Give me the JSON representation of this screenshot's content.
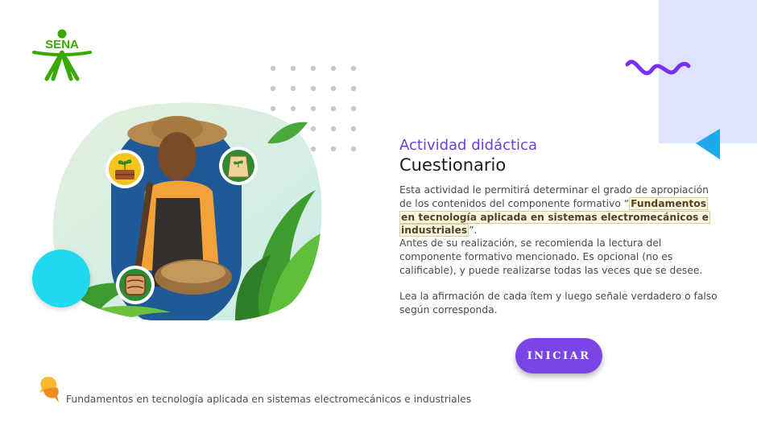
{
  "logo": {
    "text": "SENA",
    "color": "#39a900"
  },
  "activity": {
    "eyebrow": "Actividad didáctica",
    "title": "Cuestionario",
    "intro_prefix": "Esta actividad le permitirá determinar el grado de apropiación de los contenidos del componente formativo “",
    "intro_highlight": "Fundamentos en tecnología aplicada en sistemas electromecánicos e industriales",
    "intro_suffix": "”.",
    "recommendation": "Antes de su realización, se recomienda la lectura del componente formativo mencionado.  Es opcional (no es calificable), y puede realizarse todas las veces que se desee.",
    "instruction": "Lea la afirmación de cada ítem y luego señale verdadero o falso según corresponda."
  },
  "start_button": {
    "label": "INICIAR"
  },
  "footer": {
    "text": "Fundamentos en tecnología aplicada en sistemas electromecánicos e industriales"
  },
  "icons": {
    "logo": "sena-logo-icon",
    "wave": "wave-decoration-icon",
    "triangle": "triangle-decoration-icon",
    "seedling_box": "seedling-box-icon",
    "seed_bag": "seed-bag-icon",
    "soil": "soil-icon",
    "footer": "footer-pin-icon"
  },
  "colors": {
    "accent_purple": "#7a45e6",
    "eyebrow_purple": "#6a3fe0",
    "cyan": "#21d9ee",
    "lavender_panel": "#dde4fb",
    "sena_green": "#39a900",
    "highlight_bg": "#fff8e0"
  }
}
